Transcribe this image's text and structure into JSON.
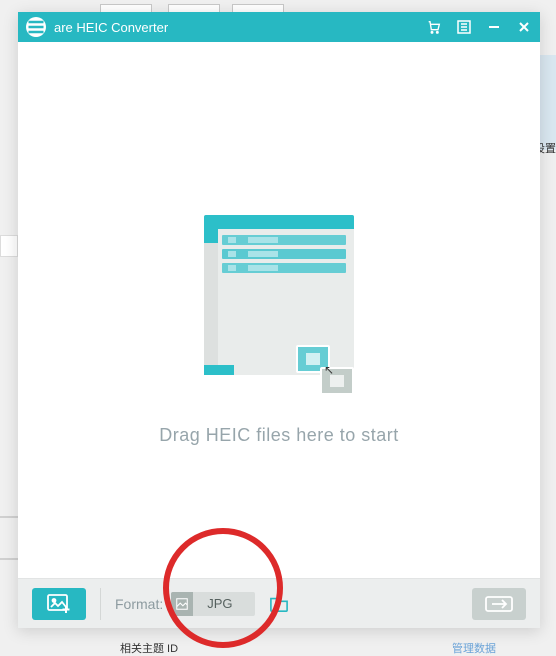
{
  "background": {
    "side_text": "设置",
    "bottom_label": "相关主题 ID",
    "bottom_link": "管理数据"
  },
  "app": {
    "title": "are HEIC Converter"
  },
  "dropzone": {
    "message": "Drag HEIC files here to start"
  },
  "footer": {
    "format_label": "Format:",
    "format_value": "JPG"
  }
}
